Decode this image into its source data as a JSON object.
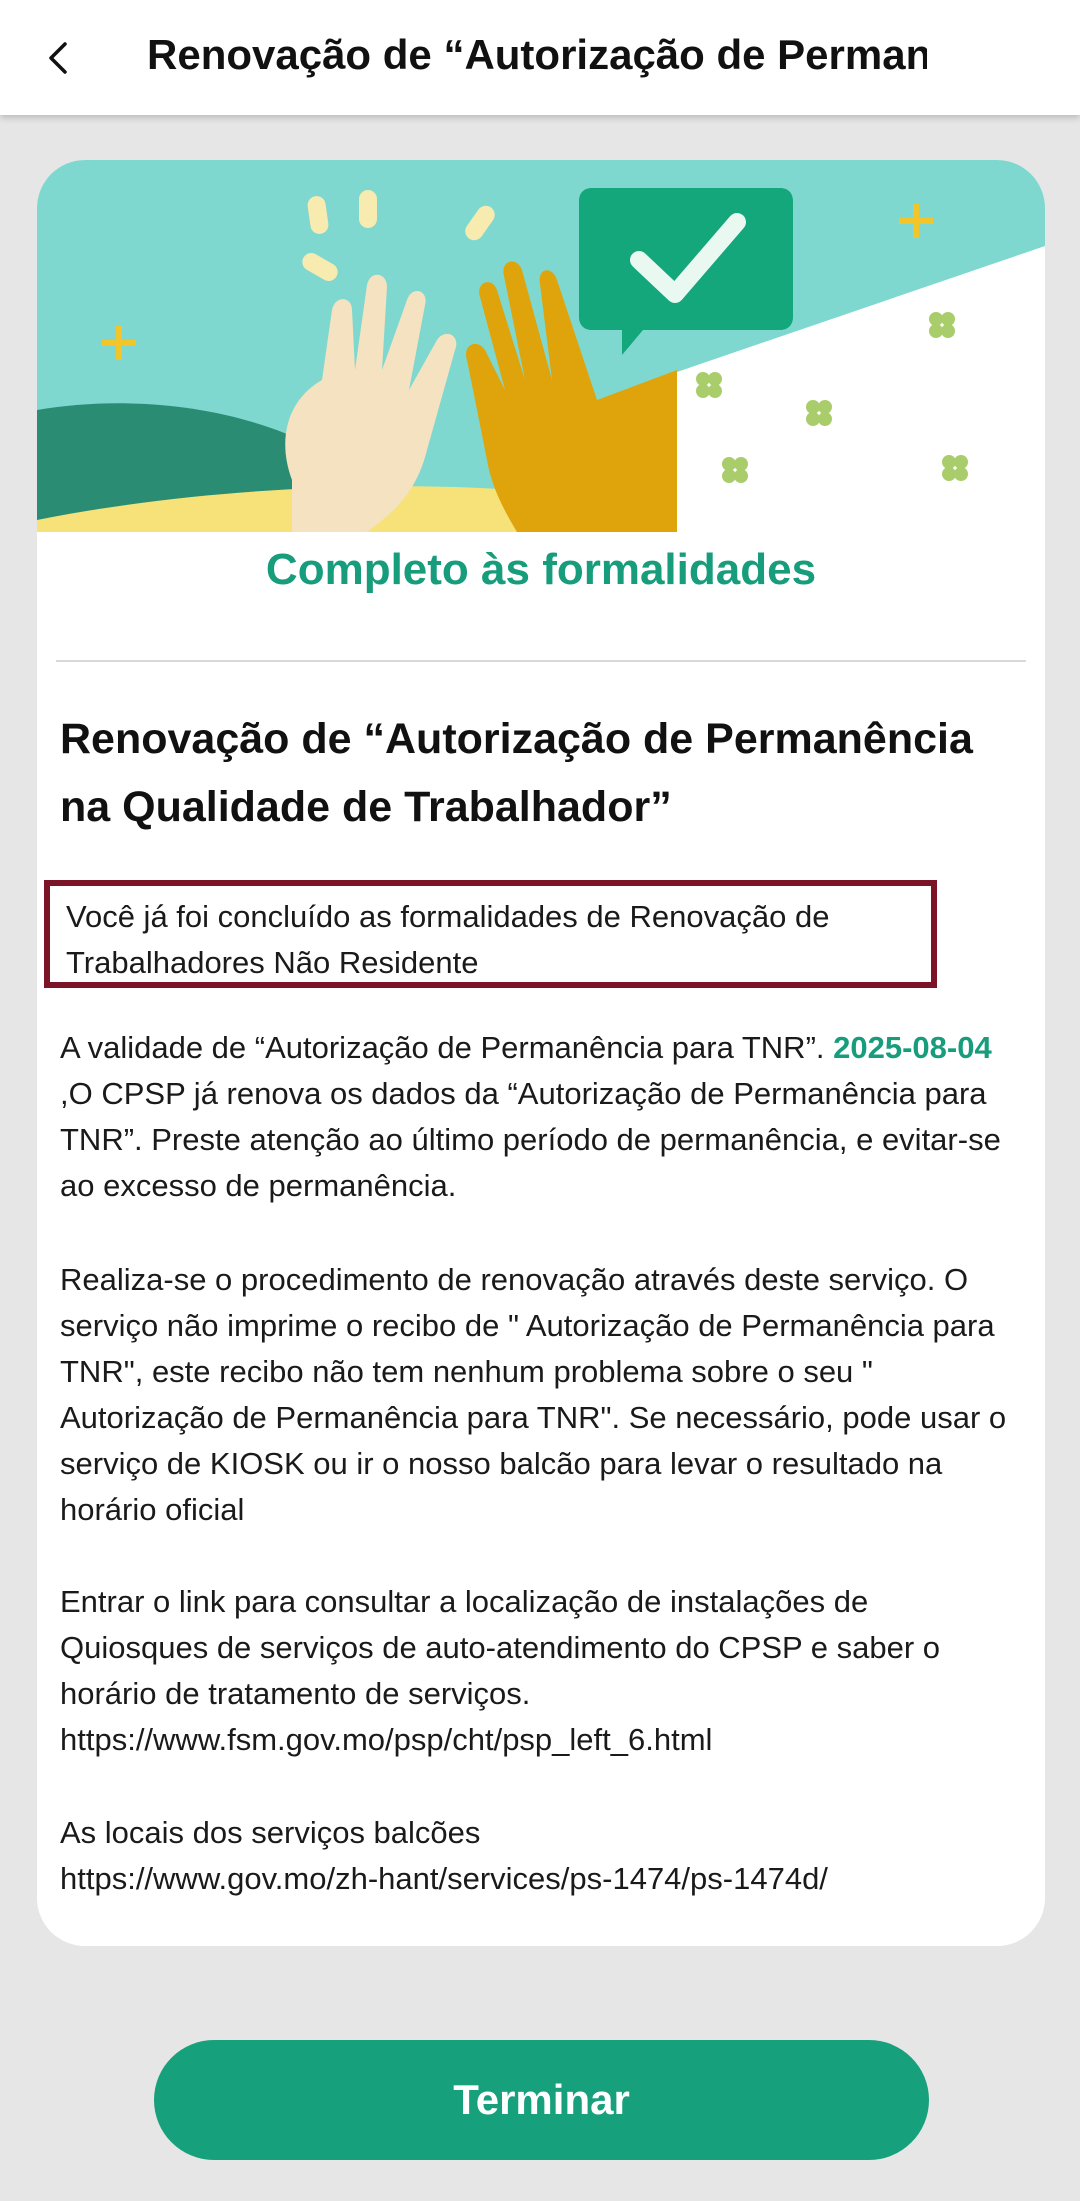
{
  "header": {
    "title": "Renovação de “Autorização de Perman...",
    "back_icon": "chevron-left-icon"
  },
  "card": {
    "heading": "Completo às formalidades",
    "service_title": "Renovação de “Autorização de Permanência na Qualidade de Trabalhador”",
    "notice": "Você já foi concluído as formalidades de Renovação de Trabalhadores Não Residente",
    "validity_prefix": "A validade de “Autorização de Permanência para TNR”. ",
    "validity_date": "2025-08-04",
    "validity_suffix": " ,O CPSP já renova os dados da “Autorização de Permanência para TNR”. Preste atenção ao último período de permanência, e evitar-se ao excesso de permanência.",
    "procedure_text": "Realiza-se o procedimento de renovação através deste serviço. O serviço não imprime o recibo de \" Autorização de Permanência para TNR\", este recibo não tem nenhum problema sobre o seu \" Autorização de Permanência para TNR\". Se necessário, pode usar o serviço de KIOSK ou ir o nosso balcão para levar o resultado na horário oficial",
    "kiosk_text": "Entrar o link para consultar a localização de instalações de Quiosques de serviços de auto-atendimento do CPSP e saber o horário de tratamento de serviços.",
    "kiosk_link": "https://www.fsm.gov.mo/psp/cht/psp_left_6.html",
    "counters_text": "As locais dos serviços balcões",
    "counters_link": "https://www.gov.mo/zh-hant/services/ps-1474/ps-1474d/"
  },
  "finish_button": {
    "label": "Terminar"
  },
  "colors": {
    "accent": "#17a07c",
    "notice_border": "#7b1426",
    "banner_bg": "#7fd8cf"
  }
}
